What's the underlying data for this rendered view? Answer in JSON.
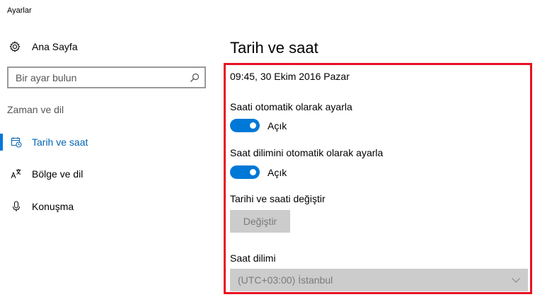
{
  "window": {
    "title": "Ayarlar"
  },
  "sidebar": {
    "home": {
      "label": "Ana Sayfa",
      "icon": "gear-icon"
    },
    "search": {
      "placeholder": "Bir ayar bulun",
      "icon": "search-icon"
    },
    "section_header": "Zaman ve dil",
    "items": [
      {
        "label": "Tarih ve saat",
        "icon": "calendar-clock-icon",
        "selected": true
      },
      {
        "label": "Bölge ve dil",
        "icon": "language-icon",
        "selected": false
      },
      {
        "label": "Konuşma",
        "icon": "microphone-icon",
        "selected": false
      }
    ]
  },
  "main": {
    "title": "Tarih ve saat",
    "current_datetime": "09:45, 30 Ekim 2016 Pazar",
    "auto_time": {
      "label": "Saati otomatik olarak ayarla",
      "state": "Açık",
      "on": true
    },
    "auto_timezone": {
      "label": "Saat dilimini otomatik olarak ayarla",
      "state": "Açık",
      "on": true
    },
    "change_datetime": {
      "label": "Tarihi ve saati değiştir",
      "button": "Değiştir"
    },
    "timezone": {
      "label": "Saat dilimi",
      "value": "(UTC+03:00) İstanbul",
      "icon": "chevron-down-icon"
    }
  },
  "colors": {
    "accent": "#0078d7",
    "highlight_frame": "#e81123",
    "disabled_bg": "#cccccc"
  }
}
